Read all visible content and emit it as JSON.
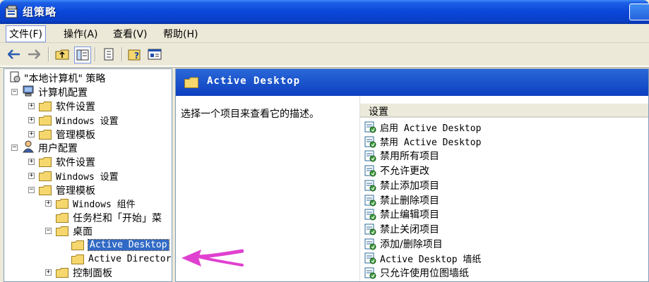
{
  "window": {
    "title": "组策略",
    "title_icon": "group-policy-icon"
  },
  "menubar": {
    "file": "文件(F)",
    "action": "操作(A)",
    "view": "查看(V)",
    "help": "帮助(H)"
  },
  "toolbar": {
    "buttons": [
      "back-icon",
      "forward-icon",
      "up-folder-icon",
      "show-hide-tree-icon",
      "export-list-icon",
      "help-icon",
      "properties-icon"
    ]
  },
  "tree": {
    "root": "\"本地计算机\" 策略",
    "computer_config": "计算机配置",
    "cc_software": "软件设置",
    "cc_windows": "Windows 设置",
    "cc_admin": "管理模板",
    "user_config": "用户配置",
    "uc_software": "软件设置",
    "uc_windows": "Windows 设置",
    "uc_admin": "管理模板",
    "windows_components": "Windows 组件",
    "taskbar": "任务栏和「开始」菜",
    "desktop": "桌面",
    "active_desktop": "Active Desktop",
    "active_directory": "Active Director",
    "control_panel": "控制面板"
  },
  "rightpane": {
    "header_title": "Active Desktop",
    "description": "选择一个项目来查看它的描述。",
    "column_header": "设置",
    "settings": [
      "启用 Active Desktop",
      "禁用 Active Desktop",
      "禁用所有项目",
      "不允许更改",
      "禁止添加项目",
      "禁止删除项目",
      "禁止编辑项目",
      "禁止关闭项目",
      "添加/删除项目",
      "Active Desktop 墙纸",
      "只允许使用位图墙纸"
    ]
  },
  "colors": {
    "titlebar": "#0a46d8",
    "selection": "#316ac5",
    "arrow": "#e040d0",
    "folder": "#f5d76e"
  }
}
